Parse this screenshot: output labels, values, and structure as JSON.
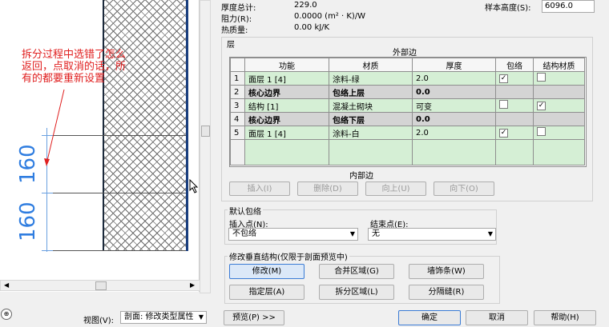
{
  "properties": {
    "thickness_label": "厚度总计:",
    "thickness_value": "229.0",
    "resistance_label": "阻力(R):",
    "resistance_value": "0.0000 (m² · K)/W",
    "thermal_mass_label": "热质量:",
    "thermal_mass_value": "0.00 kJ/K",
    "sample_height_label": "样本高度(S):",
    "sample_height_value": "6096.0"
  },
  "layers_section": {
    "title": "层",
    "exterior_label": "外部边",
    "interior_label": "内部边",
    "columns": [
      "功能",
      "材质",
      "厚度",
      "包络",
      "结构材质"
    ],
    "rows": [
      {
        "num": "1",
        "function": "面层 1 [4]",
        "material": "涂料-绿",
        "thickness": "2.0",
        "wrap": "checked",
        "structural": "unchecked",
        "kind": "layer"
      },
      {
        "num": "2",
        "function": "核心边界",
        "material": "包络上层",
        "thickness": "0.0",
        "wrap": "",
        "structural": "",
        "kind": "boundary"
      },
      {
        "num": "3",
        "function": "结构 [1]",
        "material": "混凝土砌块",
        "thickness": "可变",
        "wrap": "unchecked",
        "structural": "checked",
        "kind": "layer"
      },
      {
        "num": "4",
        "function": "核心边界",
        "material": "包络下层",
        "thickness": "0.0",
        "wrap": "",
        "structural": "",
        "kind": "boundary"
      },
      {
        "num": "5",
        "function": "面层 1 [4]",
        "material": "涂料-白",
        "thickness": "2.0",
        "wrap": "checked",
        "structural": "unchecked",
        "kind": "layer"
      }
    ],
    "buttons": {
      "insert": "插入(I)",
      "delete": "删除(D)",
      "up": "向上(U)",
      "down": "向下(O)"
    }
  },
  "wrapping": {
    "title": "默认包络",
    "insert_label": "插入点(N):",
    "insert_value": "不包络",
    "end_label": "结束点(E):",
    "end_value": "无"
  },
  "vertical": {
    "title": "修改垂直结构(仅限于剖面预览中)",
    "modify": "修改(M)",
    "merge": "合并区域(G)",
    "sweeps": "墙饰条(W)",
    "assign": "指定层(A)",
    "split": "拆分区域(L)",
    "reveals": "分隔缝(R)"
  },
  "preview": {
    "note": "拆分过程中选错了怎么返回，点取消的话，所有的都要重新设置",
    "dim1": "160",
    "dim2": "160"
  },
  "footer": {
    "view_label": "视图(V):",
    "view_value": "剖面: 修改类型属性",
    "preview_button": "预览(P) >>",
    "ok": "确定",
    "cancel": "取消",
    "help": "帮助(H)"
  },
  "colors": {
    "green_row": "#d5efd5",
    "boundary_row": "#d4d4d4",
    "annotation_red": "#e02020",
    "dimension_blue": "#2f7de0"
  }
}
